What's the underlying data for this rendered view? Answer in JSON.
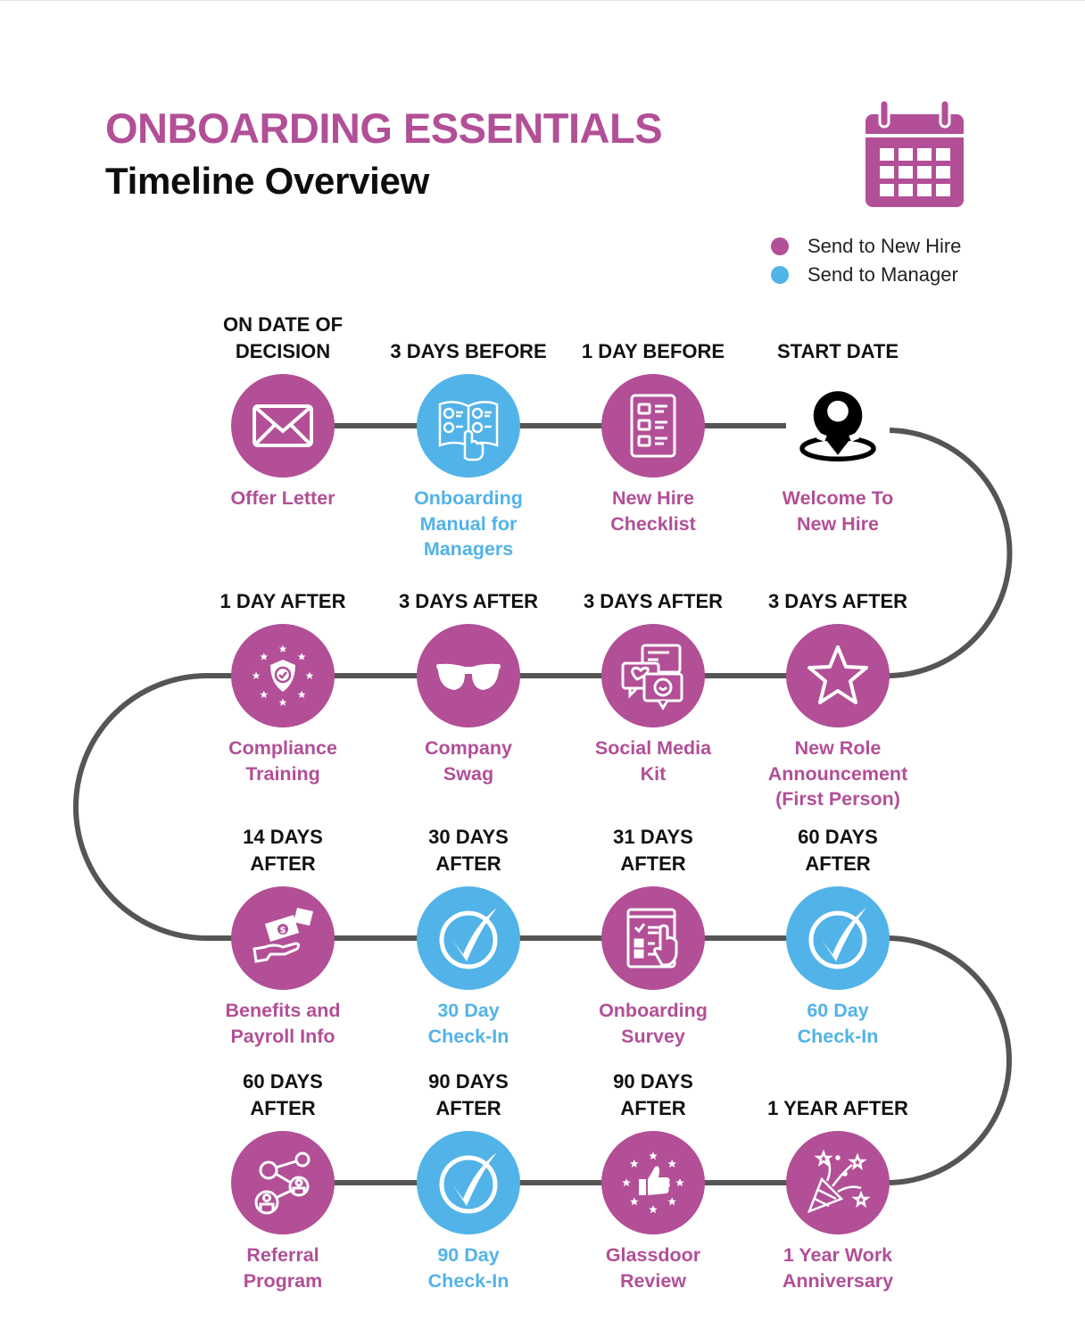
{
  "header": {
    "title": "ONBOARDING ESSENTIALS",
    "subtitle": "Timeline Overview",
    "icon": "calendar-icon"
  },
  "colors": {
    "new_hire": "#b24f97",
    "manager": "#52b3e8",
    "path": "#555555",
    "heading_text": "#111111"
  },
  "legend": [
    {
      "label": "Send to New Hire",
      "audience": "new_hire"
    },
    {
      "label": "Send to Manager",
      "audience": "manager"
    }
  ],
  "timeline": {
    "rows": [
      {
        "direction": "left-to-right",
        "steps": [
          {
            "when": [
              "ON DATE OF",
              "DECISION"
            ],
            "label": [
              "Offer Letter"
            ],
            "audience": "new_hire",
            "icon": "envelope-icon"
          },
          {
            "when": [
              "3 DAYS BEFORE"
            ],
            "label": [
              "Onboarding",
              "Manual for",
              "Managers"
            ],
            "audience": "manager",
            "icon": "manual-book-icon"
          },
          {
            "when": [
              "1 DAY BEFORE"
            ],
            "label": [
              "New Hire",
              "Checklist"
            ],
            "audience": "new_hire",
            "icon": "checklist-icon"
          },
          {
            "when": [
              "START DATE"
            ],
            "label": [
              "Welcome To",
              "New Hire"
            ],
            "audience": "new_hire",
            "icon": "location-pin-icon"
          }
        ]
      },
      {
        "direction": "right-to-left",
        "steps": [
          {
            "when": [
              "3 DAYS AFTER"
            ],
            "label": [
              "New Role",
              "Announcement",
              "(First Person)"
            ],
            "audience": "new_hire",
            "icon": "star-icon"
          },
          {
            "when": [
              "3 DAYS AFTER"
            ],
            "label": [
              "Social Media",
              "Kit"
            ],
            "audience": "new_hire",
            "icon": "chat-bubbles-icon"
          },
          {
            "when": [
              "3 DAYS AFTER"
            ],
            "label": [
              "Company",
              "Swag"
            ],
            "audience": "new_hire",
            "icon": "sunglasses-icon"
          },
          {
            "when": [
              "1 DAY AFTER"
            ],
            "label": [
              "Compliance",
              "Training"
            ],
            "audience": "new_hire",
            "icon": "shield-stars-icon"
          }
        ]
      },
      {
        "direction": "left-to-right",
        "steps": [
          {
            "when": [
              "14 DAYS",
              "AFTER"
            ],
            "label": [
              "Benefits and",
              "Payroll Info"
            ],
            "audience": "new_hire",
            "icon": "money-hand-icon"
          },
          {
            "when": [
              "30 DAYS",
              "AFTER"
            ],
            "label": [
              "30 Day",
              "Check-In"
            ],
            "audience": "manager",
            "icon": "check-circle-icon"
          },
          {
            "when": [
              "31 DAYS",
              "AFTER"
            ],
            "label": [
              "Onboarding",
              "Survey"
            ],
            "audience": "new_hire",
            "icon": "survey-form-icon"
          },
          {
            "when": [
              "60 DAYS",
              "AFTER"
            ],
            "label": [
              "60 Day",
              "Check-In"
            ],
            "audience": "manager",
            "icon": "check-circle-icon"
          }
        ]
      },
      {
        "direction": "right-to-left",
        "steps": [
          {
            "when": [
              "1 YEAR AFTER"
            ],
            "label": [
              "1 Year Work",
              "Anniversary"
            ],
            "audience": "new_hire",
            "icon": "party-popper-icon"
          },
          {
            "when": [
              "90 DAYS",
              "AFTER"
            ],
            "label": [
              "Glassdoor",
              "Review"
            ],
            "audience": "new_hire",
            "icon": "thumbs-up-stars-icon"
          },
          {
            "when": [
              "90 DAYS",
              "AFTER"
            ],
            "label": [
              "90 Day",
              "Check-In"
            ],
            "audience": "manager",
            "icon": "check-circle-icon"
          },
          {
            "when": [
              "60 DAYS",
              "AFTER"
            ],
            "label": [
              "Referral",
              "Program"
            ],
            "audience": "new_hire",
            "icon": "referral-network-icon"
          }
        ]
      }
    ]
  }
}
